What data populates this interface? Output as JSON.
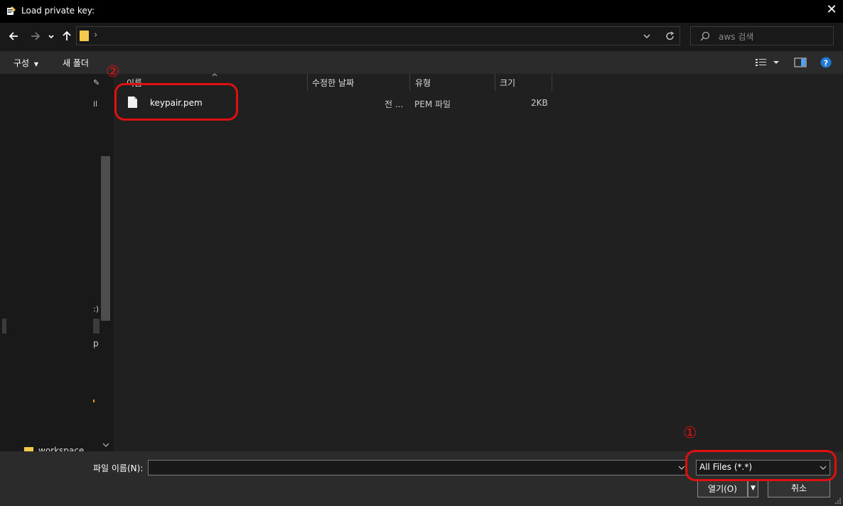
{
  "window": {
    "title": "Load private key:"
  },
  "nav": {
    "back_icon": "arrow-left-icon",
    "forward_icon": "arrow-right-icon",
    "recent_icon": "chevron-down-icon",
    "up_icon": "arrow-up-icon",
    "path_separator": "›",
    "refresh_icon": "refresh-icon",
    "search_placeholder": "aws 검색"
  },
  "toolbar": {
    "organize_label": "구성",
    "new_folder_label": "새 폴더"
  },
  "left_pane": {
    "fragments": [
      "il",
      ":)",
      "p"
    ],
    "workspace_label": "workspace"
  },
  "columns": [
    {
      "label": "이름"
    },
    {
      "label": "수정한 날짜"
    },
    {
      "label": "유형"
    },
    {
      "label": "크기"
    }
  ],
  "files": [
    {
      "name": "keypair.pem",
      "modified": "전 ...",
      "type": "PEM 파일",
      "size": "2KB"
    }
  ],
  "bottom": {
    "filename_label": "파일 이름(N):",
    "filename_value": "",
    "filter_value": "All Files (*.*)",
    "open_label": "열기(O)",
    "cancel_label": "취소"
  },
  "annotations": {
    "marker_1": "①",
    "marker_2": "②"
  },
  "colors": {
    "annotation_red": "#e01010",
    "folder_yellow": "#f5c94b",
    "help_blue": "#1e78d7"
  }
}
